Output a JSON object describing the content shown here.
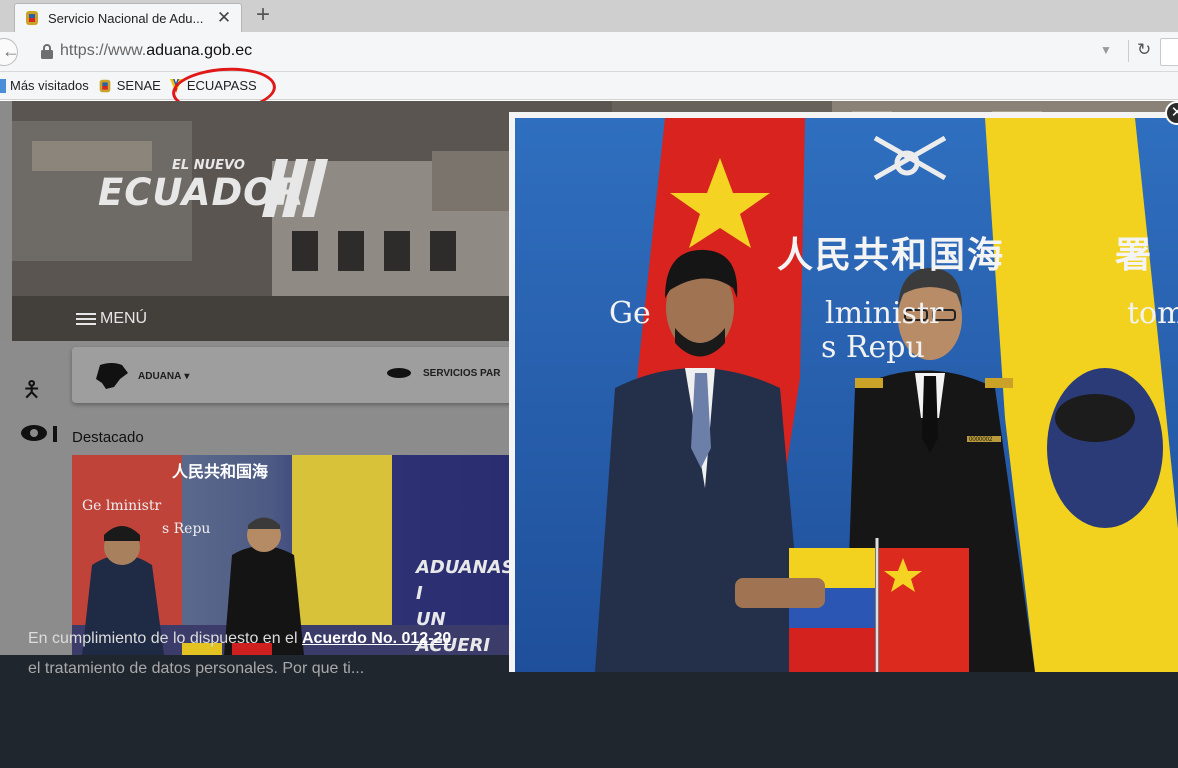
{
  "browser": {
    "tab_title": "Servicio Nacional de Adu...",
    "url_prefix": "https://www.",
    "url_domain": "aduana.gob.ec",
    "bookmarks": [
      {
        "label": "Más visitados"
      },
      {
        "label": "SENAE"
      },
      {
        "label": "ECUAPASS"
      }
    ],
    "accent_color": "#e01818"
  },
  "site": {
    "logo_small": "EL NUEVO",
    "logo_main": "ECUADOR",
    "menu_label": "MENÚ",
    "nav": {
      "aduana_label": "ADUANA",
      "servicios_label": "SERVICIOS PAR"
    },
    "section_title": "Destacado",
    "banner_lines": [
      "ADUANAS I",
      "UN ACUERI"
    ],
    "notice_text": "En cumplimiento de lo dispuesto en el ",
    "notice_link": "Acuerdo No. 012-20",
    "notice_line2": "el tratamiento de datos personales. Por que ti..."
  },
  "lightbox": {
    "zh_text": "人民共和国海",
    "zh_end": "署",
    "en_line1_left": "Ge",
    "en_line1_mid": "lministr",
    "en_line1_right": "tom",
    "en_line2": "s Repu",
    "badge_number": "0000002",
    "close_label": "✕"
  }
}
